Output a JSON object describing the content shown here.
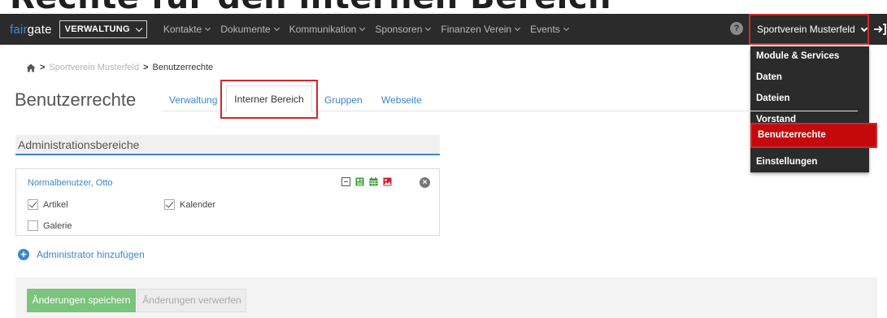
{
  "page_heading_fragment": "Rechte für den internen Bereich",
  "navbar": {
    "logo_accent": "fair",
    "logo_rest": "gate",
    "module_select": "VERWALTUNG",
    "items": [
      {
        "label": "Kontakte"
      },
      {
        "label": "Dokumente"
      },
      {
        "label": "Kommunikation"
      },
      {
        "label": "Sponsoren"
      },
      {
        "label": "Finanzen Verein"
      },
      {
        "label": "Events"
      }
    ],
    "help_icon": "?",
    "club_name": "Sportverein Musterfeld"
  },
  "dropdown": {
    "items": [
      {
        "label": "Module & Services"
      },
      {
        "label": "Daten"
      },
      {
        "label": "Dateien"
      },
      {
        "label": "Vorstand"
      },
      {
        "label": "Benutzerrechte"
      },
      {
        "label": "Einstellungen"
      }
    ]
  },
  "breadcrumb": {
    "parent": "Sportverein Musterfeld",
    "separator": ">",
    "current": "Benutzerrechte"
  },
  "page_title": "Benutzerrechte",
  "tabs": [
    {
      "label": "Verwaltung"
    },
    {
      "label": "Interner Bereich"
    },
    {
      "label": "Gruppen"
    },
    {
      "label": "Webseite"
    }
  ],
  "section_title": "Administrationsbereiche",
  "admin_card": {
    "name": "Normalbenutzer, Otto",
    "remove_glyph": "×",
    "permissions": [
      {
        "label": "Artikel",
        "checked": true
      },
      {
        "label": "Kalender",
        "checked": true
      },
      {
        "label": "Galerie",
        "checked": false
      }
    ]
  },
  "add_admin": {
    "glyph": "+",
    "label": "Administrator hinzufügen"
  },
  "footer": {
    "save_label": "Änderungen speichern",
    "discard_label": "Änderungen verwerfen"
  },
  "colors": {
    "navbar_bg": "#2b2b2b",
    "accent_blue": "#3c87c8",
    "highlight_red": "#d0282a",
    "active_menu_red": "#c4080c",
    "save_green": "#7bc47b"
  }
}
